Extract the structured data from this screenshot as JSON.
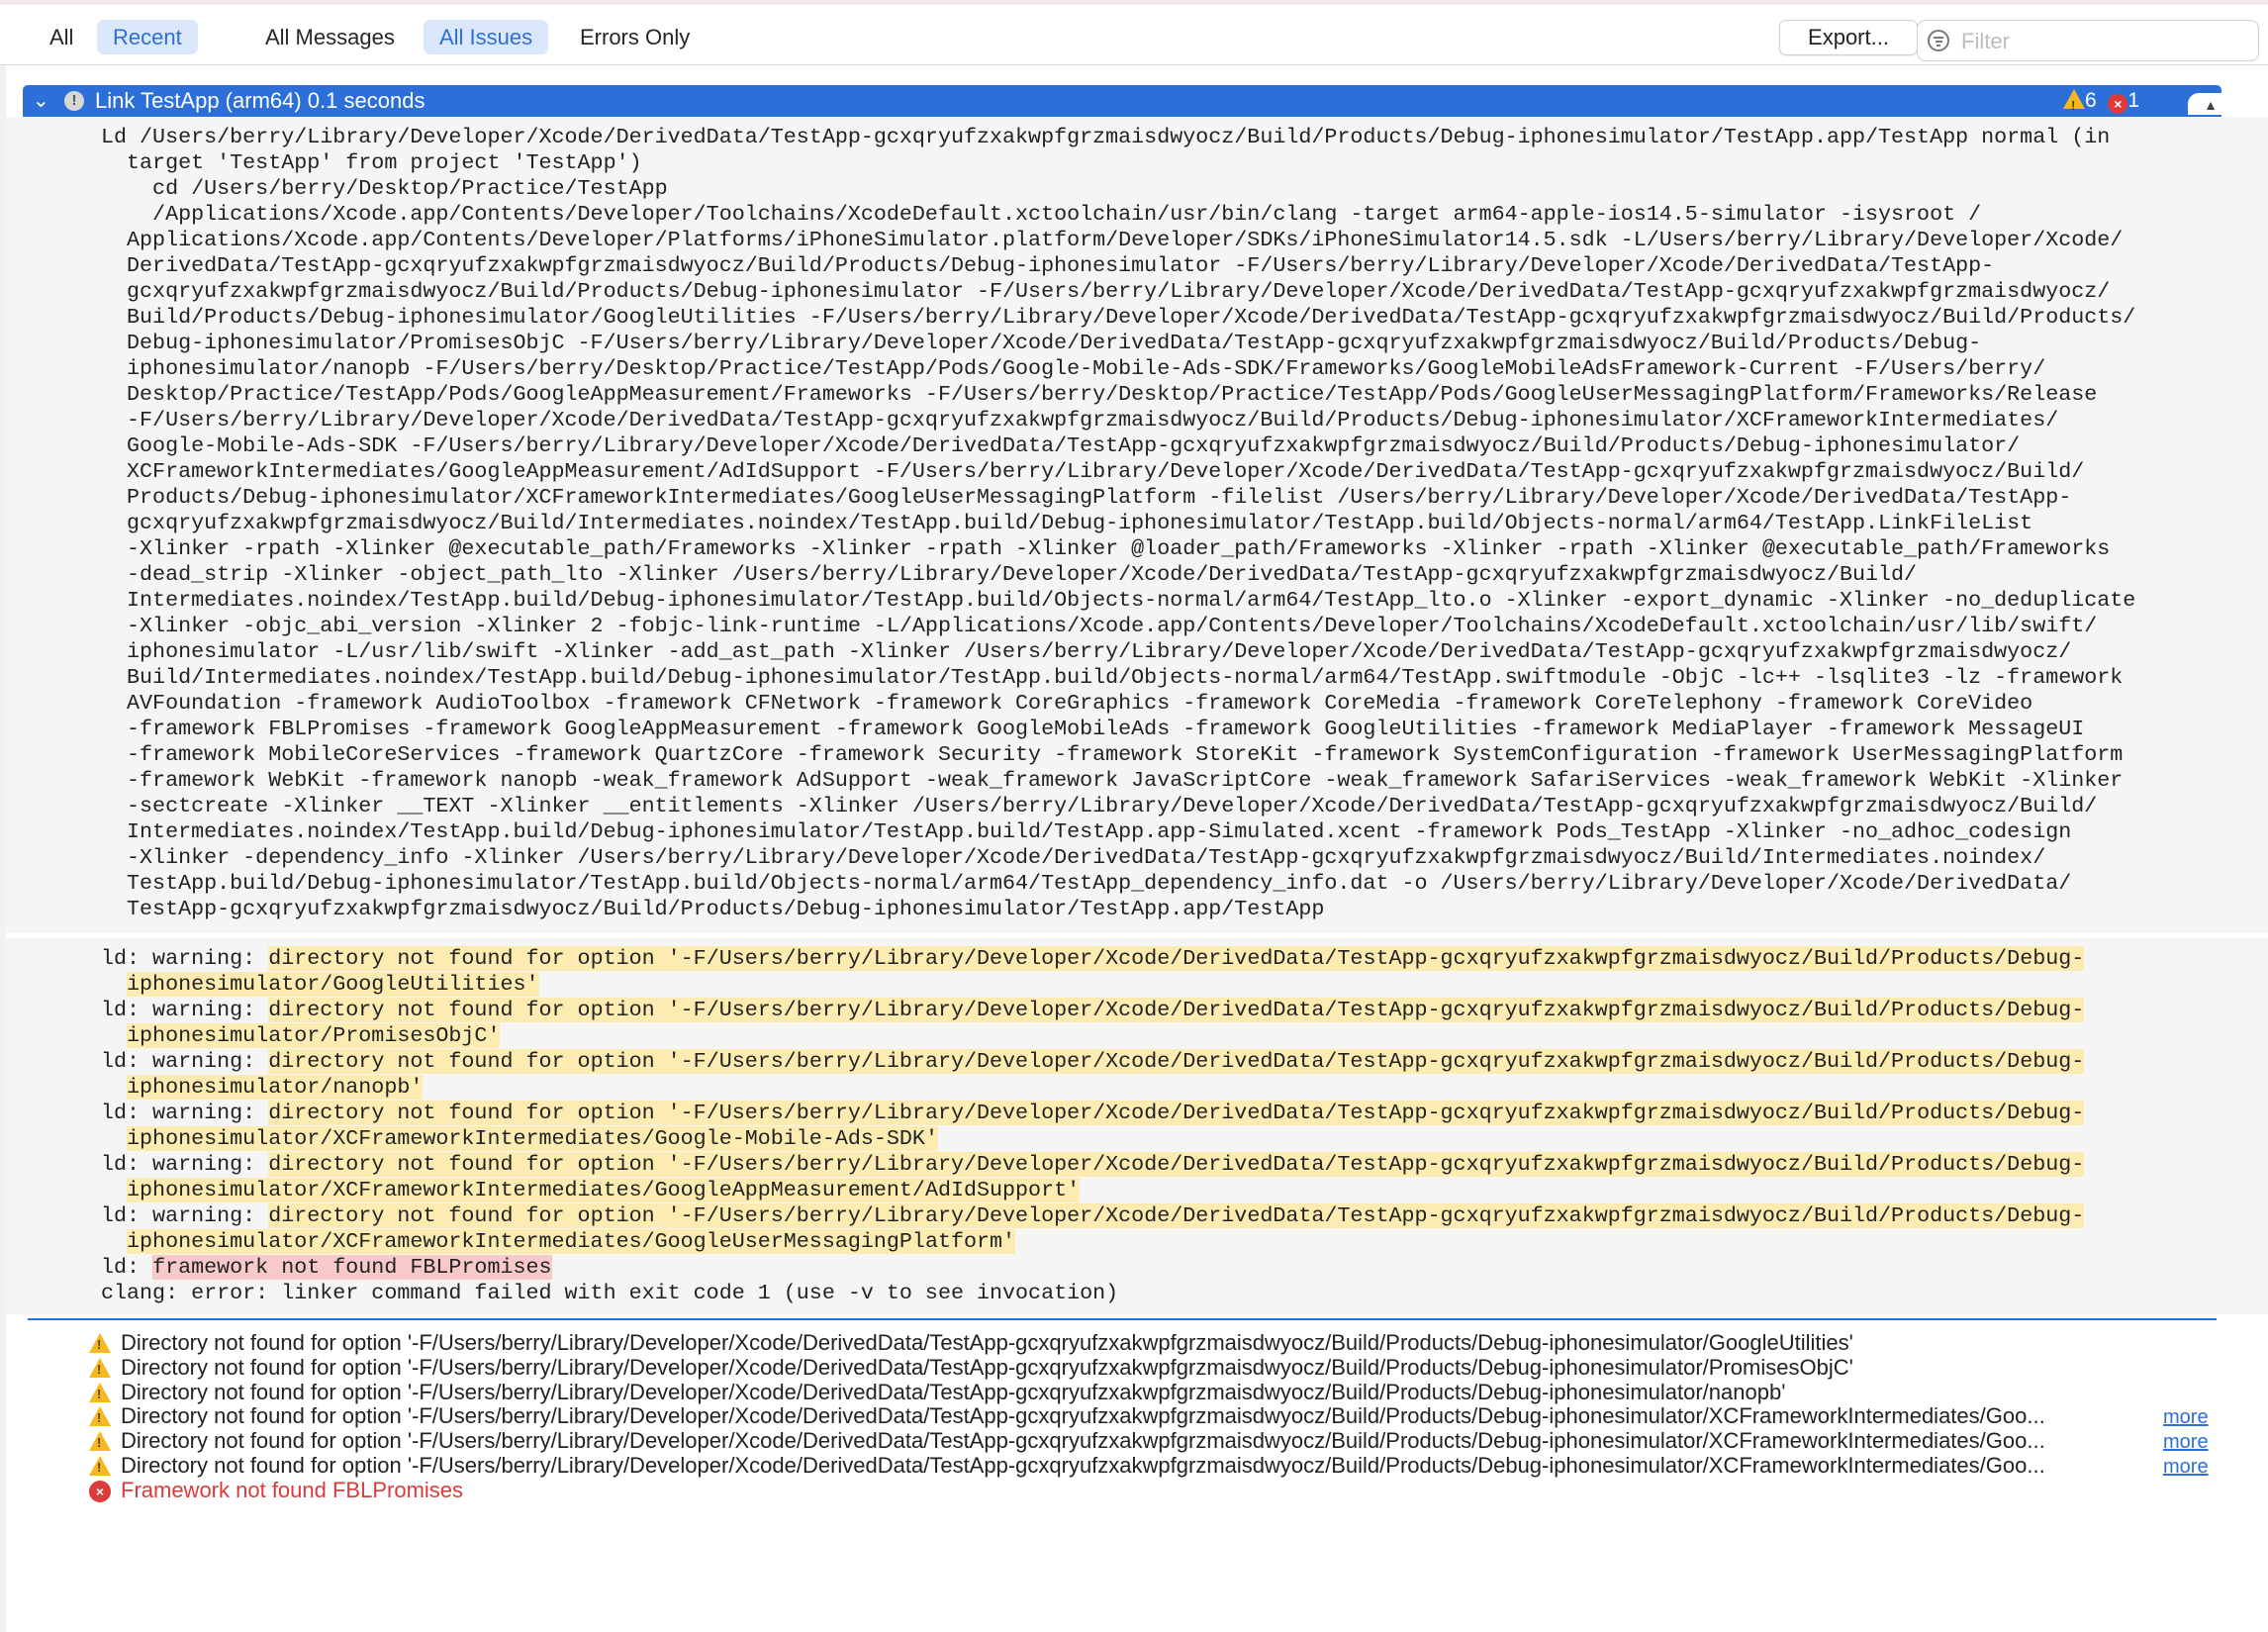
{
  "toolbar": {
    "scope_tabs": [
      "All",
      "Recent"
    ],
    "filter_tabs": [
      "All Messages",
      "All Issues",
      "Errors Only"
    ],
    "export_label": "Export...",
    "filter_placeholder": "Filter"
  },
  "header": {
    "title": "Link TestApp (arm64)  0.1 seconds",
    "warning_count": "6",
    "error_count": "1"
  },
  "command_lines": [
    "Ld /Users/berry/Library/Developer/Xcode/DerivedData/TestApp-gcxqryufzxakwpfgrzmaisdwyocz/Build/Products/Debug-iphonesimulator/TestApp.app/TestApp normal (in",
    "  target 'TestApp' from project 'TestApp')",
    "    cd /Users/berry/Desktop/Practice/TestApp",
    "    /Applications/Xcode.app/Contents/Developer/Toolchains/XcodeDefault.xctoolchain/usr/bin/clang -target arm64-apple-ios14.5-simulator -isysroot /",
    "  Applications/Xcode.app/Contents/Developer/Platforms/iPhoneSimulator.platform/Developer/SDKs/iPhoneSimulator14.5.sdk -L/Users/berry/Library/Developer/Xcode/",
    "  DerivedData/TestApp-gcxqryufzxakwpfgrzmaisdwyocz/Build/Products/Debug-iphonesimulator -F/Users/berry/Library/Developer/Xcode/DerivedData/TestApp-",
    "  gcxqryufzxakwpfgrzmaisdwyocz/Build/Products/Debug-iphonesimulator -F/Users/berry/Library/Developer/Xcode/DerivedData/TestApp-gcxqryufzxakwpfgrzmaisdwyocz/",
    "  Build/Products/Debug-iphonesimulator/GoogleUtilities -F/Users/berry/Library/Developer/Xcode/DerivedData/TestApp-gcxqryufzxakwpfgrzmaisdwyocz/Build/Products/",
    "  Debug-iphonesimulator/PromisesObjC -F/Users/berry/Library/Developer/Xcode/DerivedData/TestApp-gcxqryufzxakwpfgrzmaisdwyocz/Build/Products/Debug-",
    "  iphonesimulator/nanopb -F/Users/berry/Desktop/Practice/TestApp/Pods/Google-Mobile-Ads-SDK/Frameworks/GoogleMobileAdsFramework-Current -F/Users/berry/",
    "  Desktop/Practice/TestApp/Pods/GoogleAppMeasurement/Frameworks -F/Users/berry/Desktop/Practice/TestApp/Pods/GoogleUserMessagingPlatform/Frameworks/Release",
    "  -F/Users/berry/Library/Developer/Xcode/DerivedData/TestApp-gcxqryufzxakwpfgrzmaisdwyocz/Build/Products/Debug-iphonesimulator/XCFrameworkIntermediates/",
    "  Google-Mobile-Ads-SDK -F/Users/berry/Library/Developer/Xcode/DerivedData/TestApp-gcxqryufzxakwpfgrzmaisdwyocz/Build/Products/Debug-iphonesimulator/",
    "  XCFrameworkIntermediates/GoogleAppMeasurement/AdIdSupport -F/Users/berry/Library/Developer/Xcode/DerivedData/TestApp-gcxqryufzxakwpfgrzmaisdwyocz/Build/",
    "  Products/Debug-iphonesimulator/XCFrameworkIntermediates/GoogleUserMessagingPlatform -filelist /Users/berry/Library/Developer/Xcode/DerivedData/TestApp-",
    "  gcxqryufzxakwpfgrzmaisdwyocz/Build/Intermediates.noindex/TestApp.build/Debug-iphonesimulator/TestApp.build/Objects-normal/arm64/TestApp.LinkFileList",
    "  -Xlinker -rpath -Xlinker @executable_path/Frameworks -Xlinker -rpath -Xlinker @loader_path/Frameworks -Xlinker -rpath -Xlinker @executable_path/Frameworks",
    "  -dead_strip -Xlinker -object_path_lto -Xlinker /Users/berry/Library/Developer/Xcode/DerivedData/TestApp-gcxqryufzxakwpfgrzmaisdwyocz/Build/",
    "  Intermediates.noindex/TestApp.build/Debug-iphonesimulator/TestApp.build/Objects-normal/arm64/TestApp_lto.o -Xlinker -export_dynamic -Xlinker -no_deduplicate",
    "  -Xlinker -objc_abi_version -Xlinker 2 -fobjc-link-runtime -L/Applications/Xcode.app/Contents/Developer/Toolchains/XcodeDefault.xctoolchain/usr/lib/swift/",
    "  iphonesimulator -L/usr/lib/swift -Xlinker -add_ast_path -Xlinker /Users/berry/Library/Developer/Xcode/DerivedData/TestApp-gcxqryufzxakwpfgrzmaisdwyocz/",
    "  Build/Intermediates.noindex/TestApp.build/Debug-iphonesimulator/TestApp.build/Objects-normal/arm64/TestApp.swiftmodule -ObjC -lc++ -lsqlite3 -lz -framework",
    "  AVFoundation -framework AudioToolbox -framework CFNetwork -framework CoreGraphics -framework CoreMedia -framework CoreTelephony -framework CoreVideo",
    "  -framework FBLPromises -framework GoogleAppMeasurement -framework GoogleMobileAds -framework GoogleUtilities -framework MediaPlayer -framework MessageUI",
    "  -framework MobileCoreServices -framework QuartzCore -framework Security -framework StoreKit -framework SystemConfiguration -framework UserMessagingPlatform",
    "  -framework WebKit -framework nanopb -weak_framework AdSupport -weak_framework JavaScriptCore -weak_framework SafariServices -weak_framework WebKit -Xlinker",
    "  -sectcreate -Xlinker __TEXT -Xlinker __entitlements -Xlinker /Users/berry/Library/Developer/Xcode/DerivedData/TestApp-gcxqryufzxakwpfgrzmaisdwyocz/Build/",
    "  Intermediates.noindex/TestApp.build/Debug-iphonesimulator/TestApp.build/TestApp.app-Simulated.xcent -framework Pods_TestApp -Xlinker -no_adhoc_codesign",
    "  -Xlinker -dependency_info -Xlinker /Users/berry/Library/Developer/Xcode/DerivedData/TestApp-gcxqryufzxakwpfgrzmaisdwyocz/Build/Intermediates.noindex/",
    "  TestApp.build/Debug-iphonesimulator/TestApp.build/Objects-normal/arm64/TestApp_dependency_info.dat -o /Users/berry/Library/Developer/Xcode/DerivedData/",
    "  TestApp-gcxqryufzxakwpfgrzmaisdwyocz/Build/Products/Debug-iphonesimulator/TestApp.app/TestApp"
  ],
  "log_messages": [
    {
      "prefix": "ld: warning: ",
      "line1": "directory not found for option '-F/Users/berry/Library/Developer/Xcode/DerivedData/TestApp-gcxqryufzxakwpfgrzmaisdwyocz/Build/Products/Debug-",
      "line2": "iphonesimulator/GoogleUtilities'"
    },
    {
      "prefix": "ld: warning: ",
      "line1": "directory not found for option '-F/Users/berry/Library/Developer/Xcode/DerivedData/TestApp-gcxqryufzxakwpfgrzmaisdwyocz/Build/Products/Debug-",
      "line2": "iphonesimulator/PromisesObjC'"
    },
    {
      "prefix": "ld: warning: ",
      "line1": "directory not found for option '-F/Users/berry/Library/Developer/Xcode/DerivedData/TestApp-gcxqryufzxakwpfgrzmaisdwyocz/Build/Products/Debug-",
      "line2": "iphonesimulator/nanopb'"
    },
    {
      "prefix": "ld: warning: ",
      "line1": "directory not found for option '-F/Users/berry/Library/Developer/Xcode/DerivedData/TestApp-gcxqryufzxakwpfgrzmaisdwyocz/Build/Products/Debug-",
      "line2": "iphonesimulator/XCFrameworkIntermediates/Google-Mobile-Ads-SDK'"
    },
    {
      "prefix": "ld: warning: ",
      "line1": "directory not found for option '-F/Users/berry/Library/Developer/Xcode/DerivedData/TestApp-gcxqryufzxakwpfgrzmaisdwyocz/Build/Products/Debug-",
      "line2": "iphonesimulator/XCFrameworkIntermediates/GoogleAppMeasurement/AdIdSupport'"
    },
    {
      "prefix": "ld: warning: ",
      "line1": "directory not found for option '-F/Users/berry/Library/Developer/Xcode/DerivedData/TestApp-gcxqryufzxakwpfgrzmaisdwyocz/Build/Products/Debug-",
      "line2": "iphonesimulator/XCFrameworkIntermediates/GoogleUserMessagingPlatform'"
    }
  ],
  "ld_error": {
    "prefix": "ld: ",
    "message": "framework not found FBLPromises"
  },
  "clang_error": "clang: error: linker command failed with exit code 1 (use -v to see invocation)",
  "issues": [
    {
      "type": "warning",
      "icon": "warning-icon",
      "text": "Directory not found for option '-F/Users/berry/Library/Developer/Xcode/DerivedData/TestApp-gcxqryufzxakwpfgrzmaisdwyocz/Build/Products/Debug-iphonesimulator/GoogleUtilities'",
      "more": ""
    },
    {
      "type": "warning",
      "icon": "warning-icon",
      "text": "Directory not found for option '-F/Users/berry/Library/Developer/Xcode/DerivedData/TestApp-gcxqryufzxakwpfgrzmaisdwyocz/Build/Products/Debug-iphonesimulator/PromisesObjC'",
      "more": ""
    },
    {
      "type": "warning",
      "icon": "warning-icon",
      "text": "Directory not found for option '-F/Users/berry/Library/Developer/Xcode/DerivedData/TestApp-gcxqryufzxakwpfgrzmaisdwyocz/Build/Products/Debug-iphonesimulator/nanopb'",
      "more": ""
    },
    {
      "type": "warning",
      "icon": "warning-icon",
      "text": "Directory not found for option '-F/Users/berry/Library/Developer/Xcode/DerivedData/TestApp-gcxqryufzxakwpfgrzmaisdwyocz/Build/Products/Debug-iphonesimulator/XCFrameworkIntermediates/Goo...",
      "more": "more"
    },
    {
      "type": "warning",
      "icon": "warning-icon",
      "text": "Directory not found for option '-F/Users/berry/Library/Developer/Xcode/DerivedData/TestApp-gcxqryufzxakwpfgrzmaisdwyocz/Build/Products/Debug-iphonesimulator/XCFrameworkIntermediates/Goo...",
      "more": "more"
    },
    {
      "type": "warning",
      "icon": "warning-icon",
      "text": "Directory not found for option '-F/Users/berry/Library/Developer/Xcode/DerivedData/TestApp-gcxqryufzxakwpfgrzmaisdwyocz/Build/Products/Debug-iphonesimulator/XCFrameworkIntermediates/Goo...",
      "more": "more"
    },
    {
      "type": "error",
      "icon": "error-icon",
      "text": "Framework not found FBLPromises",
      "more": ""
    }
  ],
  "colors": {
    "accent": "#2d6fd8",
    "warning_highlight": "#fcecb2",
    "error_highlight": "#f7c9c9",
    "error_text": "#d93b3b",
    "warning_icon": "#f5b821"
  }
}
